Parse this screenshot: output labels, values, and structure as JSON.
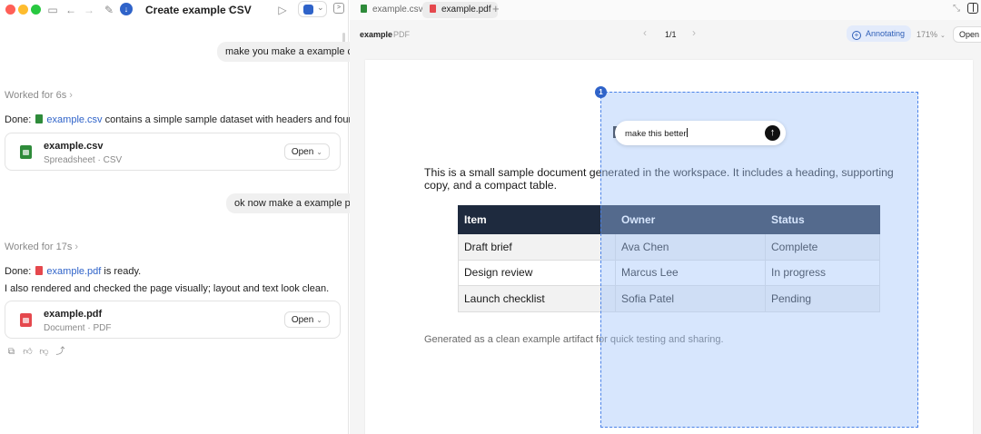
{
  "window": {
    "chat_title": "Create example CSV",
    "more_label": "···",
    "badge_icon": "download-icon"
  },
  "chat": {
    "messages": [
      {
        "role": "user",
        "text": "make you make a example csv"
      },
      {
        "role": "status",
        "text": "Worked for 6s"
      },
      {
        "role": "assistant",
        "prefix": "Done:",
        "file": "example.csv",
        "suffix": "contains a simple sample dataset with headers and four rows."
      },
      {
        "role": "user",
        "text": "ok now make a example pdf"
      },
      {
        "role": "status",
        "text": "Worked for 17s"
      },
      {
        "role": "assistant",
        "prefix": "Done:",
        "file": "example.pdf",
        "suffix": "is ready."
      },
      {
        "role": "assistant",
        "text": "I also rendered and checked the page visually; layout and text look clean."
      }
    ],
    "cards": [
      {
        "name": "example.csv",
        "meta": "Spreadsheet · CSV",
        "open_label": "Open",
        "icon": "spreadsheet-icon"
      },
      {
        "name": "example.pdf",
        "meta": "Document · PDF",
        "open_label": "Open",
        "icon": "pdf-icon"
      }
    ],
    "actions": [
      "copy-icon",
      "thumbs-up-icon",
      "thumbs-down-icon",
      "share-icon"
    ]
  },
  "viewer": {
    "tabs": [
      {
        "label": "example.csv",
        "active": false,
        "color": "#2e8b3a"
      },
      {
        "label": "example.pdf",
        "active": true,
        "color": "#e5484d"
      }
    ],
    "add_tab": "+",
    "doc_name": "example",
    "doc_type": "PDF",
    "page_indicator": "1/1",
    "annotate_label": "Annotating",
    "zoom": "171%",
    "open_label": "Open"
  },
  "pdf": {
    "intro": "This is a small sample document generated in the workspace. It includes a heading, supporting copy, and a compact table.",
    "table": {
      "headers": [
        "Item",
        "Owner",
        "Status"
      ],
      "rows": [
        [
          "Draft brief",
          "Ava Chen",
          "Complete"
        ],
        [
          "Design review",
          "Marcus Lee",
          "In progress"
        ],
        [
          "Launch checklist",
          "Sofia Patel",
          "Pending"
        ]
      ]
    },
    "footer": "Generated as a clean example artifact for quick testing and sharing."
  },
  "annotation": {
    "number": "1",
    "input_value": "make this better",
    "accent": "#2f63c9"
  }
}
